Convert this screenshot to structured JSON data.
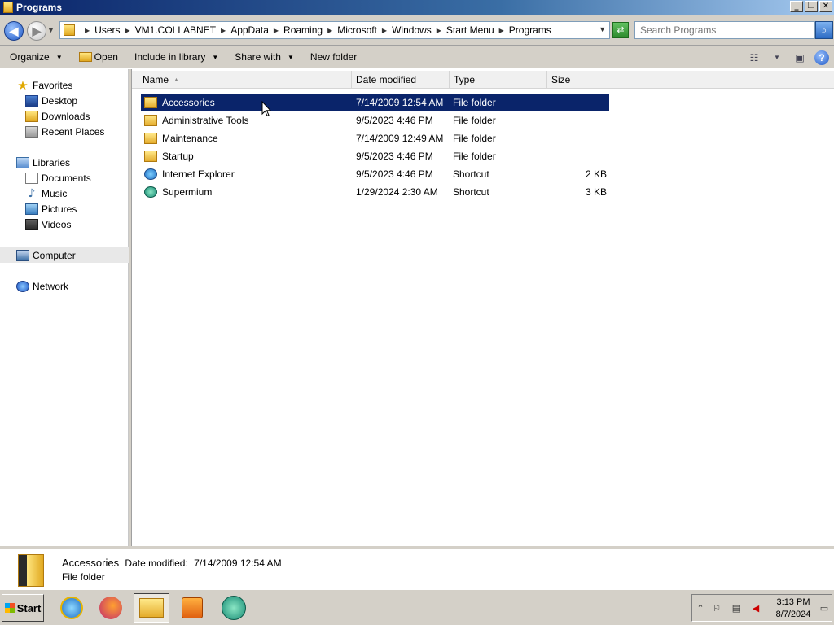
{
  "window": {
    "title": "Programs",
    "buttons": {
      "minimize": "_",
      "restore": "❐",
      "close": "✕"
    }
  },
  "address": {
    "crumbs": [
      "Users",
      "VM1.COLLABNET",
      "AppData",
      "Roaming",
      "Microsoft",
      "Windows",
      "Start Menu",
      "Programs"
    ],
    "search_placeholder": "Search Programs"
  },
  "toolbar": {
    "organize": "Organize",
    "open": "Open",
    "include_in_library": "Include in library",
    "share_with": "Share with",
    "new_folder": "New folder"
  },
  "nav": {
    "favorites": {
      "label": "Favorites",
      "items": [
        "Desktop",
        "Downloads",
        "Recent Places"
      ]
    },
    "libraries": {
      "label": "Libraries",
      "items": [
        "Documents",
        "Music",
        "Pictures",
        "Videos"
      ]
    },
    "computer": "Computer",
    "network": "Network"
  },
  "columns": {
    "name": "Name",
    "date": "Date modified",
    "type": "Type",
    "size": "Size"
  },
  "files": [
    {
      "name": "Accessories",
      "date": "7/14/2009 12:54 AM",
      "type": "File folder",
      "size": "",
      "icon": "folder-icon",
      "selected": true
    },
    {
      "name": "Administrative Tools",
      "date": "9/5/2023 4:46 PM",
      "type": "File folder",
      "size": "",
      "icon": "folder-icon"
    },
    {
      "name": "Maintenance",
      "date": "7/14/2009 12:49 AM",
      "type": "File folder",
      "size": "",
      "icon": "folder-icon"
    },
    {
      "name": "Startup",
      "date": "9/5/2023 4:46 PM",
      "type": "File folder",
      "size": "",
      "icon": "folder-icon"
    },
    {
      "name": "Internet Explorer",
      "date": "9/5/2023 4:46 PM",
      "type": "Shortcut",
      "size": "2 KB",
      "icon": "internet-explorer-icon"
    },
    {
      "name": "Supermium",
      "date": "1/29/2024 2:30 AM",
      "type": "Shortcut",
      "size": "3 KB",
      "icon": "supermium-icon"
    }
  ],
  "details": {
    "name": "Accessories",
    "date_label": "Date modified:",
    "date_value": "7/14/2009 12:54 AM",
    "type": "File folder"
  },
  "taskbar": {
    "start": "Start",
    "time": "3:13 PM",
    "date": "8/7/2024"
  },
  "colors": {
    "selection": "#0a246a",
    "chrome": "#d4d0c8"
  }
}
